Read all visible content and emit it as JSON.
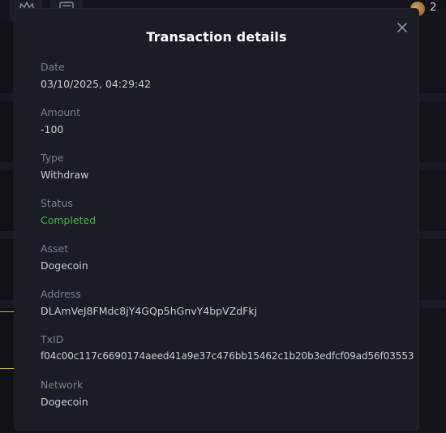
{
  "background": {
    "balance_partial": "2"
  },
  "modal": {
    "title": "Transaction details",
    "fields": [
      {
        "label": "Date",
        "value": "03/10/2025, 04:29:42"
      },
      {
        "label": "Amount",
        "value": "-100"
      },
      {
        "label": "Type",
        "value": "Withdraw"
      },
      {
        "label": "Status",
        "value": "Completed"
      },
      {
        "label": "Asset",
        "value": "Dogecoin"
      },
      {
        "label": "Address",
        "value": "DLAmVeJ8FMdc8jY4GQp5hGnvY4bpVZdFkj"
      },
      {
        "label": "TxID",
        "value": "f04c00c117c6690174aeed41a9e37c476bb15462c1b20b3edfcf09ad56f03553"
      },
      {
        "label": "Network",
        "value": "Dogecoin"
      }
    ]
  },
  "colors": {
    "modal_bg": "#1a1d26",
    "label": "#7b8190",
    "value": "#c9cdd6",
    "status_completed": "#3fb93f",
    "title": "#ffffff"
  },
  "icons": {
    "close": "close-icon",
    "crown": "crown-icon",
    "list": "list-icon",
    "coin": "coin-icon"
  }
}
